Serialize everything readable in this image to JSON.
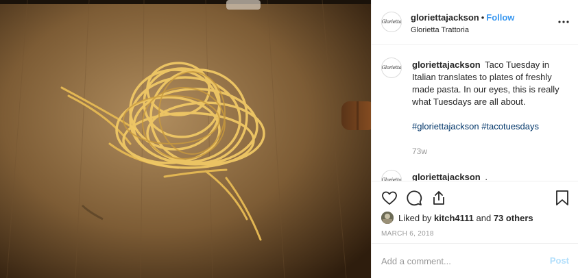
{
  "post": {
    "username": "gloriettajackson",
    "follow_label": "Follow",
    "location": "Glorietta Trattoria",
    "avatar_text": "Glorietta"
  },
  "caption": {
    "username": "gloriettajackson",
    "text": "Taco Tuesday in Italian translates to plates of freshly made pasta. In our eyes, this is really what Tuesdays are all about.",
    "hashtags": [
      "#gloriettajackson",
      "#tacotuesdays"
    ],
    "time": "73w"
  },
  "next_comment": {
    "username": "gloriettajackson",
    "text": "."
  },
  "likes": {
    "prefix": "Liked by",
    "user": "kitch4111",
    "conjunction": "and",
    "others": "73 others"
  },
  "date": "MARCH 6, 2018",
  "comment_box": {
    "placeholder": "Add a comment...",
    "post_label": "Post"
  },
  "colors": {
    "link": "#3897f0",
    "hashtag": "#003569",
    "post_disabled": "#b2dffc"
  },
  "icons": [
    "heart-icon",
    "comment-icon",
    "share-icon",
    "bookmark-icon",
    "more-icon"
  ]
}
